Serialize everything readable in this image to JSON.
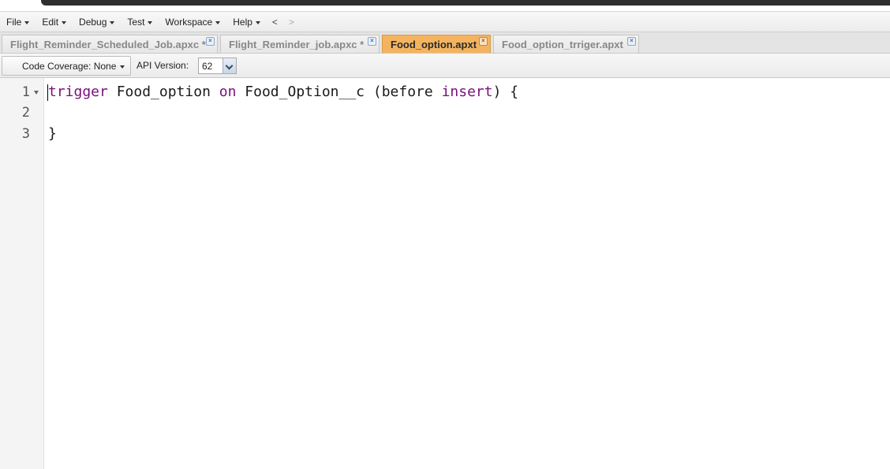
{
  "menubar": {
    "items": [
      "File",
      "Edit",
      "Debug",
      "Test",
      "Workspace",
      "Help"
    ],
    "back_arrow": "<",
    "forward_arrow": ">"
  },
  "tabs": [
    {
      "label": "Flight_Reminder_Scheduled_Job.apxc *",
      "active": false
    },
    {
      "label": "Flight_Reminder_job.apxc *",
      "active": false
    },
    {
      "label": "Food_option.apxt",
      "active": true
    },
    {
      "label": "Food_option_trriger.apxt",
      "active": false
    }
  ],
  "toolbar": {
    "coverage_label": "Code Coverage: None",
    "api_label": "API Version:",
    "api_value": "62"
  },
  "editor": {
    "line_numbers": [
      "1",
      "2",
      "3"
    ],
    "line1": {
      "kw_trigger": "trigger",
      "name": "Food_option",
      "kw_on": "on",
      "object": "Food_Option__c",
      "paren_open": "(before",
      "kw_insert": "insert",
      "paren_close": ") {"
    },
    "line2": "",
    "line3": "}"
  },
  "colors": {
    "active_tab": "#f4b45f",
    "keyword": "#7a0f7a"
  }
}
